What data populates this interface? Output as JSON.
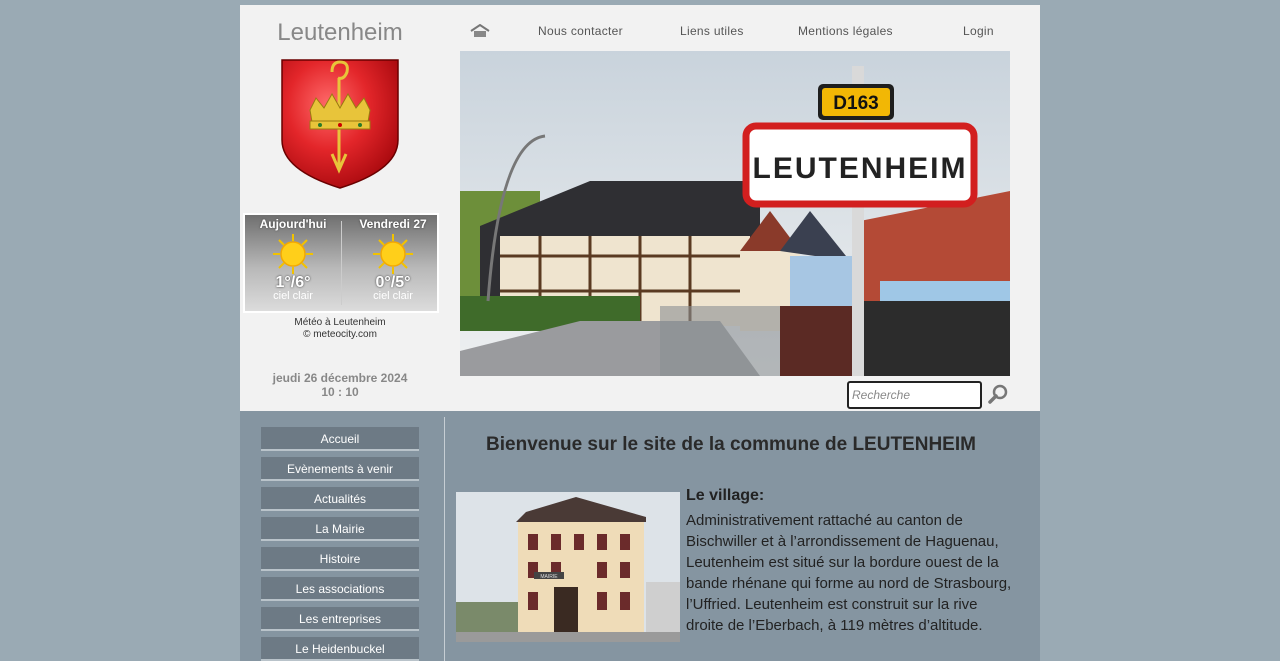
{
  "site": {
    "title": "Leutenheim"
  },
  "nav": {
    "home_icon": "home-icon",
    "contact": "Nous contacter",
    "links": "Liens utiles",
    "legal": "Mentions légales",
    "login": "Login"
  },
  "weather": {
    "days": [
      {
        "name": "Aujourd'hui",
        "icon": "sun-icon",
        "temp": "1°/6°",
        "condition": "ciel clair"
      },
      {
        "name": "Vendredi 27",
        "icon": "sun-icon",
        "temp": "0°/5°",
        "condition": "ciel clair"
      }
    ],
    "credit_line1": "Météo à Leutenheim",
    "credit_line2": "© meteocity.com"
  },
  "datetime": {
    "date": "jeudi 26 décembre 2024",
    "time": "10 : 10"
  },
  "hero": {
    "sign_text": "LEUTENHEIM",
    "route_plate": "D163"
  },
  "search": {
    "placeholder": "Recherche",
    "value": ""
  },
  "sidebar": {
    "items": [
      {
        "label": "Accueil"
      },
      {
        "label": "Evènements à venir"
      },
      {
        "label": "Actualités"
      },
      {
        "label": "La Mairie"
      },
      {
        "label": "Histoire"
      },
      {
        "label": "Les associations"
      },
      {
        "label": "Les entreprises"
      },
      {
        "label": "Le Heidenbuckel"
      }
    ]
  },
  "main": {
    "title": "Bienvenue sur le site de la commune de LEUTENHEIM",
    "section_heading": "Le village:",
    "section_text": "Administrativement rattaché au canton de Bischwiller et à l’arrondissement de Haguenau, Leutenheim est situé sur la bordure ouest de la bande rhénane qui forme au nord de Strasbourg, l’Uffried. Leutenheim est construit sur la rive droite de l’Eberbach, à 119 mètres d’altitude.",
    "photo_sign": "MAIRIE"
  },
  "colors": {
    "page_bg": "#9aaab4",
    "header_bg": "#f2f2f2",
    "content_bg": "#8595a1",
    "sidebar_button": "#6d7a85",
    "crest_red": "#e3262a",
    "crest_gold": "#e8c43a"
  }
}
